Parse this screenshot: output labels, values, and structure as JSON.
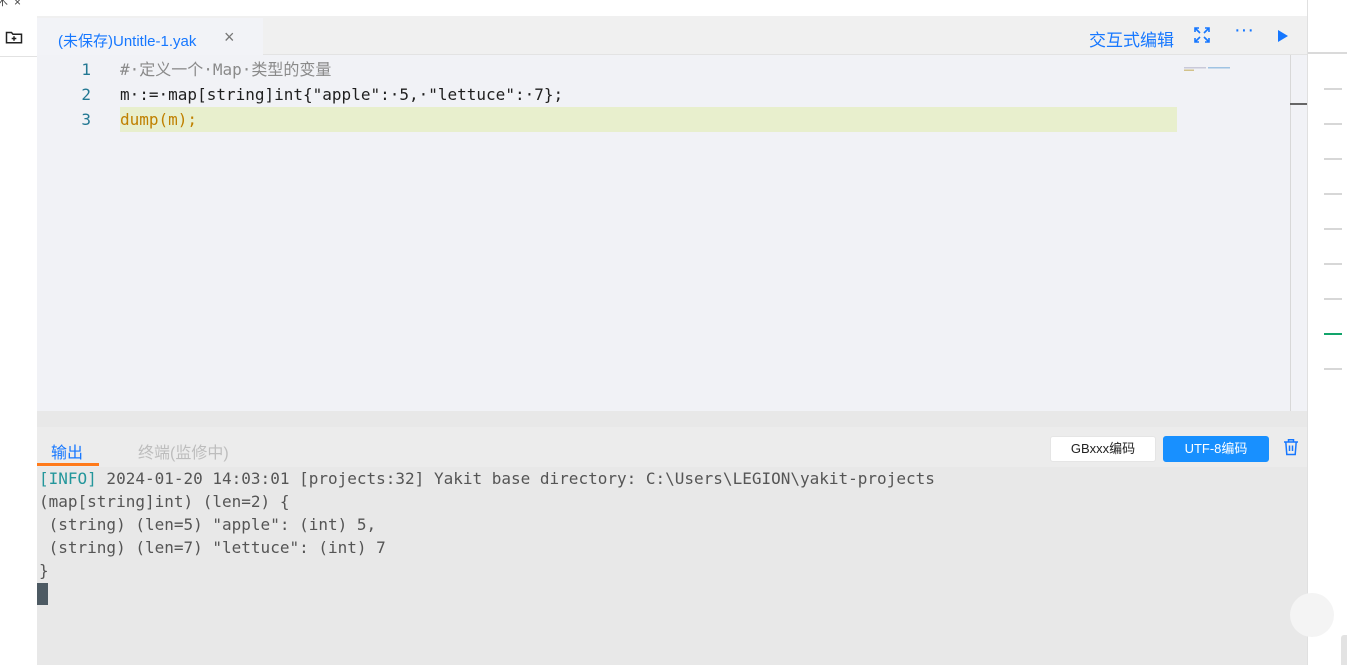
{
  "left_rail": {
    "top_tab_text": "术",
    "top_tab_close": "×"
  },
  "tab": {
    "file_name": "(未保存)Untitle-1.yak",
    "close_glyph": "×"
  },
  "toolbar": {
    "interactive_edit_label": "交互式编辑",
    "more_glyph": "···"
  },
  "editor": {
    "line_numbers": [
      "1",
      "2",
      "3"
    ],
    "lines": [
      "#·定义一个·Map·类型的变量",
      "m·:=·map[string]int{\"apple\":·5,·\"lettuce\":·7};",
      "dump(m);"
    ]
  },
  "output_panel": {
    "tab_output": "输出",
    "tab_terminal": "终端(监修中)",
    "encoding_gbk": "GBxxx编码",
    "encoding_utf8": "UTF-8编码",
    "selected_encoding": "UTF-8编码"
  },
  "console": {
    "info_tag": "[INFO]",
    "info_rest": " 2024-01-20 14:03:01 [projects:32] Yakit base directory: C:\\Users\\LEGION\\yakit-projects",
    "lines": [
      "(map[string]int) (len=2) {",
      " (string) (len=5) \"apple\": (int) 5,",
      " (string) (len=7) \"lettuce\": (int) 7",
      "}"
    ]
  },
  "colors": {
    "accent": "#1677ff",
    "active_line": "#e8efcd",
    "tab_underline": "#ff7a1a",
    "info": "#23969b",
    "green_tick": "#12a46b"
  },
  "icons": [
    "folder-add-icon",
    "fullscreen-icon",
    "more-icon",
    "run-icon",
    "trash-icon",
    "close-icon"
  ]
}
